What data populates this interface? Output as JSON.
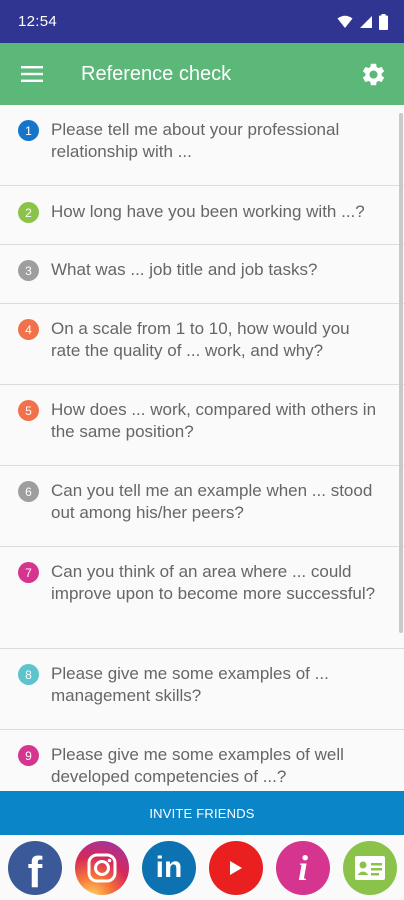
{
  "status_bar": {
    "time": "12:54"
  },
  "app_bar": {
    "title": "Reference check"
  },
  "questions": [
    {
      "number": "1",
      "text": "Please tell me about your professional relationship with ...",
      "color": "#1576c9"
    },
    {
      "number": "2",
      "text": "How long have you been working with ...?",
      "color": "#8bc34a"
    },
    {
      "number": "3",
      "text": "What was ... job title and job tasks?",
      "color": "#9e9e9e"
    },
    {
      "number": "4",
      "text": "On a scale from 1 to 10, how would you rate the quality of ... work, and why?",
      "color": "#f0714a"
    },
    {
      "number": "5",
      "text": "How does ... work, compared with others in the same position?",
      "color": "#f0714a"
    },
    {
      "number": "6",
      "text": "Can you tell me an example when ... stood out among his/her peers?",
      "color": "#9e9e9e"
    },
    {
      "number": "7",
      "text": "Can you think of an area where ... could improve upon to become more successful?",
      "color": "#d6358f"
    },
    {
      "number": "8",
      "text": "Please give me some examples of ... management skills?",
      "color": "#5ec4cc"
    },
    {
      "number": "9",
      "text": "Please give me some examples of well developed competencies of ...?",
      "color": "#d6358f"
    }
  ],
  "invite": {
    "label": "INVITE FRIENDS"
  },
  "social": [
    {
      "name": "facebook",
      "icon": "facebook-icon",
      "glyph": "f",
      "color": "#3b5998"
    },
    {
      "name": "instagram",
      "icon": "instagram-icon",
      "color": "#d6295b"
    },
    {
      "name": "linkedin",
      "icon": "linkedin-icon",
      "glyph": "in",
      "color": "#0d72b1"
    },
    {
      "name": "youtube",
      "icon": "youtube-icon",
      "color": "#ea1f1f"
    },
    {
      "name": "info",
      "icon": "info-icon",
      "glyph": "i",
      "color": "#d6358f"
    },
    {
      "name": "contact",
      "icon": "contact-card-icon",
      "color": "#8bc34a"
    }
  ]
}
